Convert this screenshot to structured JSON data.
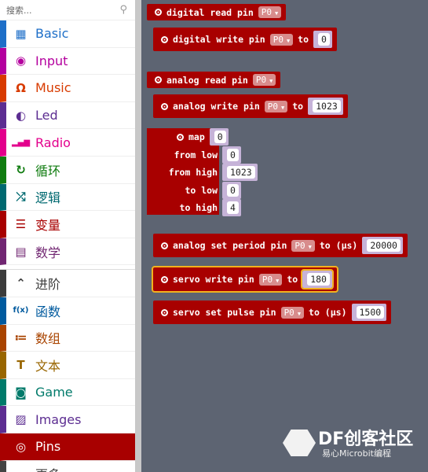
{
  "sidebar": {
    "search_placeholder": "搜索...",
    "categories": [
      {
        "label": "Basic",
        "icon": "grid-icon",
        "color": "#1e6fc8"
      },
      {
        "label": "Input",
        "icon": "radio-button-icon",
        "color": "#b4009e"
      },
      {
        "label": "Music",
        "icon": "headphones-icon",
        "color": "#d83b01"
      },
      {
        "label": "Led",
        "icon": "toggle-icon",
        "color": "#5c2d91"
      },
      {
        "label": "Radio",
        "icon": "signal-bars-icon",
        "color": "#e3008c"
      },
      {
        "label": "循环",
        "icon": "refresh-icon",
        "color": "#107c10"
      },
      {
        "label": "逻辑",
        "icon": "shuffle-icon",
        "color": "#006970"
      },
      {
        "label": "变量",
        "icon": "list-lines-icon",
        "color": "#a80000"
      },
      {
        "label": "数学",
        "icon": "calculator-icon",
        "color": "#712672"
      },
      {
        "label": "进阶",
        "icon": "chevron-up-icon",
        "color": "#3c3c3c"
      },
      {
        "label": "函数",
        "icon": "function-icon",
        "color": "#005a9e"
      },
      {
        "label": "数组",
        "icon": "numbered-list-icon",
        "color": "#a94400"
      },
      {
        "label": "文本",
        "icon": "text-icon",
        "color": "#996600"
      },
      {
        "label": "Game",
        "icon": "gamepad-icon",
        "color": "#007a6a"
      },
      {
        "label": "Images",
        "icon": "image-icon",
        "color": "#5c2d91"
      },
      {
        "label": "Pins",
        "icon": "pin-icon",
        "color": "#a80000",
        "selected": true
      },
      {
        "label": "更多",
        "icon": "more-icon",
        "color": "#444"
      }
    ]
  },
  "blocks": {
    "digital_read": {
      "label": "digital read pin",
      "pin": "P0"
    },
    "digital_write": {
      "label": "digital write pin",
      "pin": "P0",
      "to": "to",
      "value": "0"
    },
    "analog_read": {
      "label": "analog read pin",
      "pin": "P0"
    },
    "analog_write": {
      "label": "analog write pin",
      "pin": "P0",
      "to": "to",
      "value": "1023"
    },
    "map": {
      "rows": [
        {
          "label": "map",
          "value": "0"
        },
        {
          "label": "from low",
          "value": "0"
        },
        {
          "label": "from high",
          "value": "1023"
        },
        {
          "label": "to low",
          "value": "0"
        },
        {
          "label": "to high",
          "value": "4"
        }
      ]
    },
    "analog_set_period": {
      "label": "analog set period pin",
      "pin": "P0",
      "to": "to (µs)",
      "value": "20000"
    },
    "servo_write": {
      "label": "servo write pin",
      "pin": "P0",
      "to": "to",
      "value": "180"
    },
    "servo_set_pulse": {
      "label": "servo set pulse pin",
      "pin": "P0",
      "to": "to (µs)",
      "value": "1500"
    }
  },
  "watermark": {
    "title": "DF创客社区",
    "subtitle": "易心Microbit编程"
  }
}
